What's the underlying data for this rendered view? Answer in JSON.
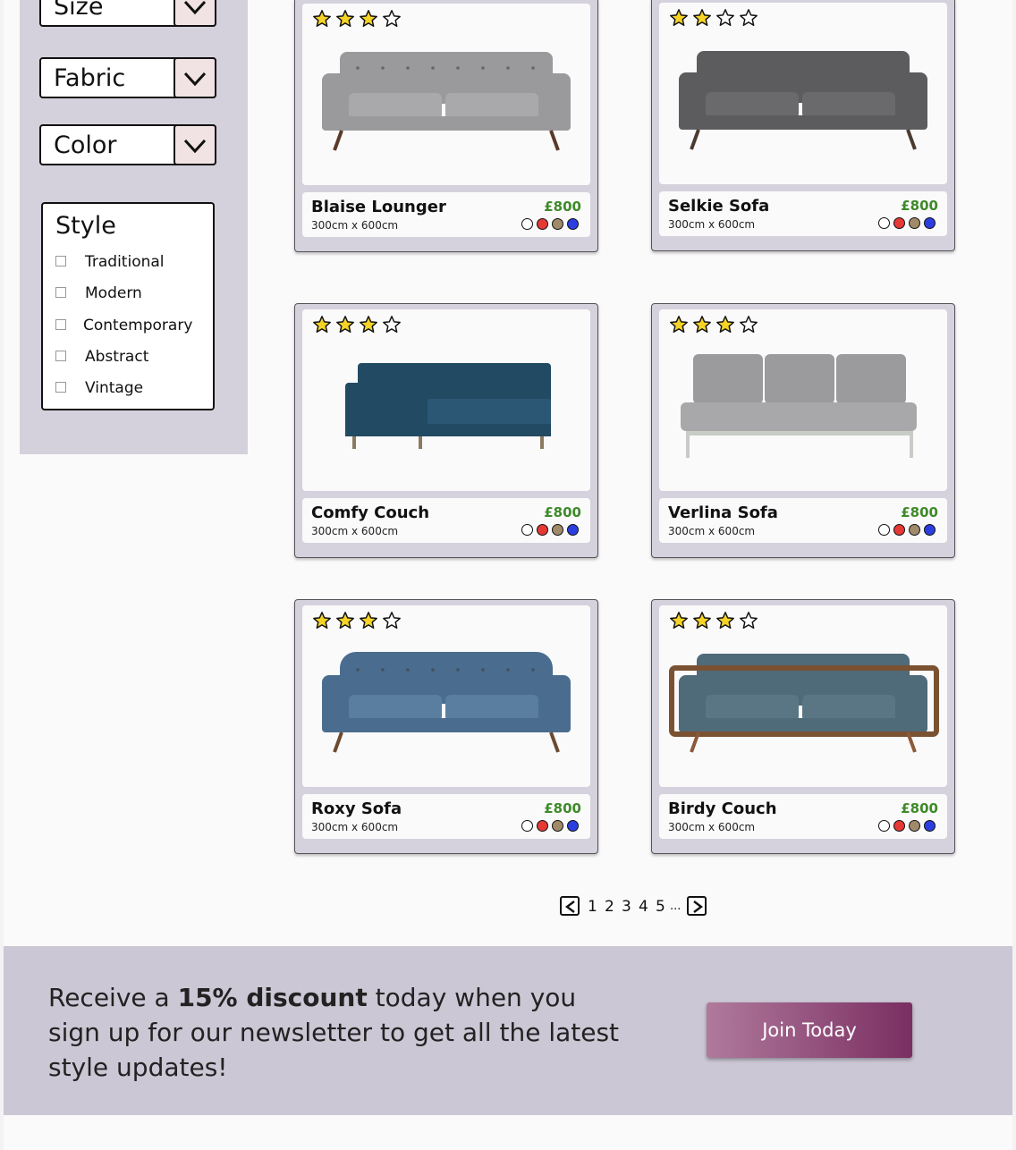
{
  "filters": {
    "dropdowns": [
      {
        "label": "Size"
      },
      {
        "label": "Fabric"
      },
      {
        "label": "Color"
      }
    ],
    "style": {
      "title": "Style",
      "options": [
        "Traditional",
        "Modern",
        "Contemporary",
        "Abstract",
        "Vintage"
      ]
    }
  },
  "products": [
    {
      "name": "Blaise Lounger",
      "dimensions": "300cm x 600cm",
      "price": "£800",
      "rating": 3,
      "max_rating": 4,
      "colors": [
        "#ffffff",
        "#e53935",
        "#a08a6a",
        "#2b3fe0"
      ],
      "icon": "sofa-image"
    },
    {
      "name": "Selkie Sofa",
      "dimensions": "300cm x 600cm",
      "price": "£800",
      "rating": 2,
      "max_rating": 4,
      "colors": [
        "#ffffff",
        "#e53935",
        "#a08a6a",
        "#2b3fe0"
      ],
      "icon": "sofa-image"
    },
    {
      "name": "Comfy Couch",
      "dimensions": "300cm x 600cm",
      "price": "£800",
      "rating": 3,
      "max_rating": 4,
      "colors": [
        "#ffffff",
        "#e53935",
        "#a08a6a",
        "#2b3fe0"
      ],
      "icon": "sofa-image"
    },
    {
      "name": "Verlina Sofa",
      "dimensions": "300cm x 600cm",
      "price": "£800",
      "rating": 3,
      "max_rating": 4,
      "colors": [
        "#ffffff",
        "#e53935",
        "#a08a6a",
        "#2b3fe0"
      ],
      "icon": "sofa-image"
    },
    {
      "name": "Roxy Sofa",
      "dimensions": "300cm x 600cm",
      "price": "£800",
      "rating": 3,
      "max_rating": 4,
      "colors": [
        "#ffffff",
        "#e53935",
        "#a08a6a",
        "#2b3fe0"
      ],
      "icon": "sofa-image"
    },
    {
      "name": "Birdy Couch",
      "dimensions": "300cm x 600cm",
      "price": "£800",
      "rating": 3,
      "max_rating": 4,
      "colors": [
        "#ffffff",
        "#e53935",
        "#a08a6a",
        "#2b3fe0"
      ],
      "icon": "sofa-image"
    }
  ],
  "pagination": {
    "pages": [
      "1",
      "2",
      "3",
      "4",
      "5"
    ],
    "ellipsis": "..."
  },
  "newsletter": {
    "text_before": "Receive a ",
    "text_bold": "15% discount",
    "text_after": " today when you sign up for our newsletter to get all the latest style updates!",
    "button_label": "Join Today"
  },
  "colors": {
    "price_green": "#3f8a2a",
    "star_yellow": "#f5d327",
    "sidebar_bg": "#d4d1dc",
    "button_gradient_start": "#b07a9c",
    "button_gradient_end": "#7a2e62"
  }
}
